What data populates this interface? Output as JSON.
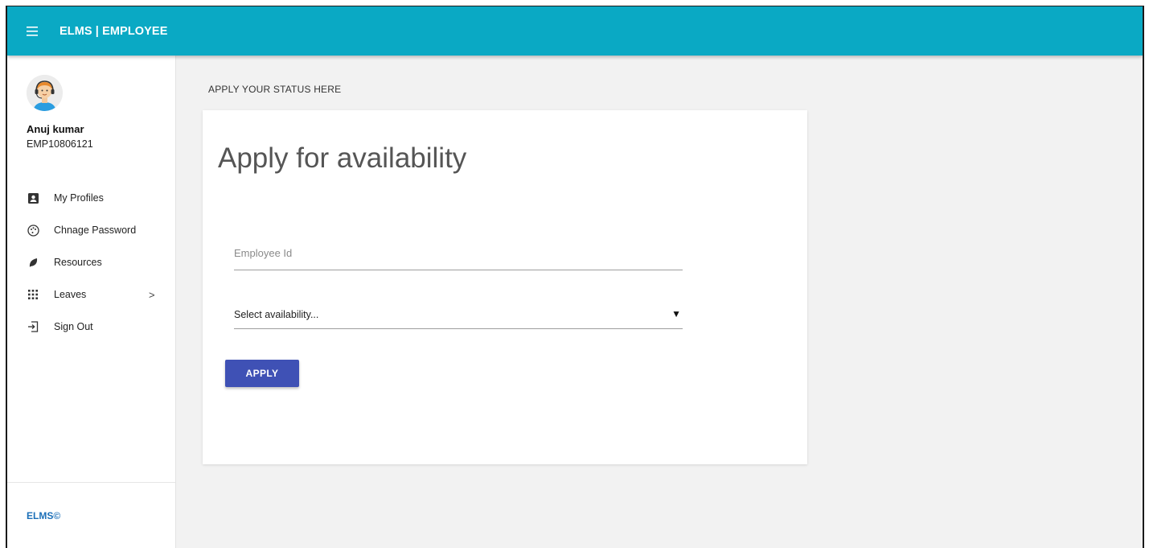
{
  "header": {
    "menu_icon": "hamburger-icon",
    "title": "ELMS | EMPLOYEE",
    "bg_color": "#0aa9c4"
  },
  "user": {
    "avatar_icon": "support-agent-avatar",
    "name": "Anuj kumar",
    "employee_id": "EMP10806121"
  },
  "sidebar": {
    "items": [
      {
        "label": "My Profiles",
        "icon": "account-box-icon"
      },
      {
        "label": "Chnage Password",
        "icon": "palette-icon"
      },
      {
        "label": "Resources",
        "icon": "leaf-icon"
      },
      {
        "label": "Leaves",
        "icon": "apps-grid-icon",
        "chevron": ">"
      },
      {
        "label": "Sign Out",
        "icon": "sign-out-icon"
      }
    ],
    "footer": "ELMS©",
    "footer_color": "#1b6fb8"
  },
  "main": {
    "section_title": "APPLY YOUR STATUS HERE",
    "card_title": "Apply for availability",
    "employee_id_placeholder": "Employee Id",
    "employee_id_value": "",
    "select_value": "Select availability...",
    "select_arrow": "▼",
    "apply_label": "APPLY",
    "apply_color": "#3f51b5"
  }
}
